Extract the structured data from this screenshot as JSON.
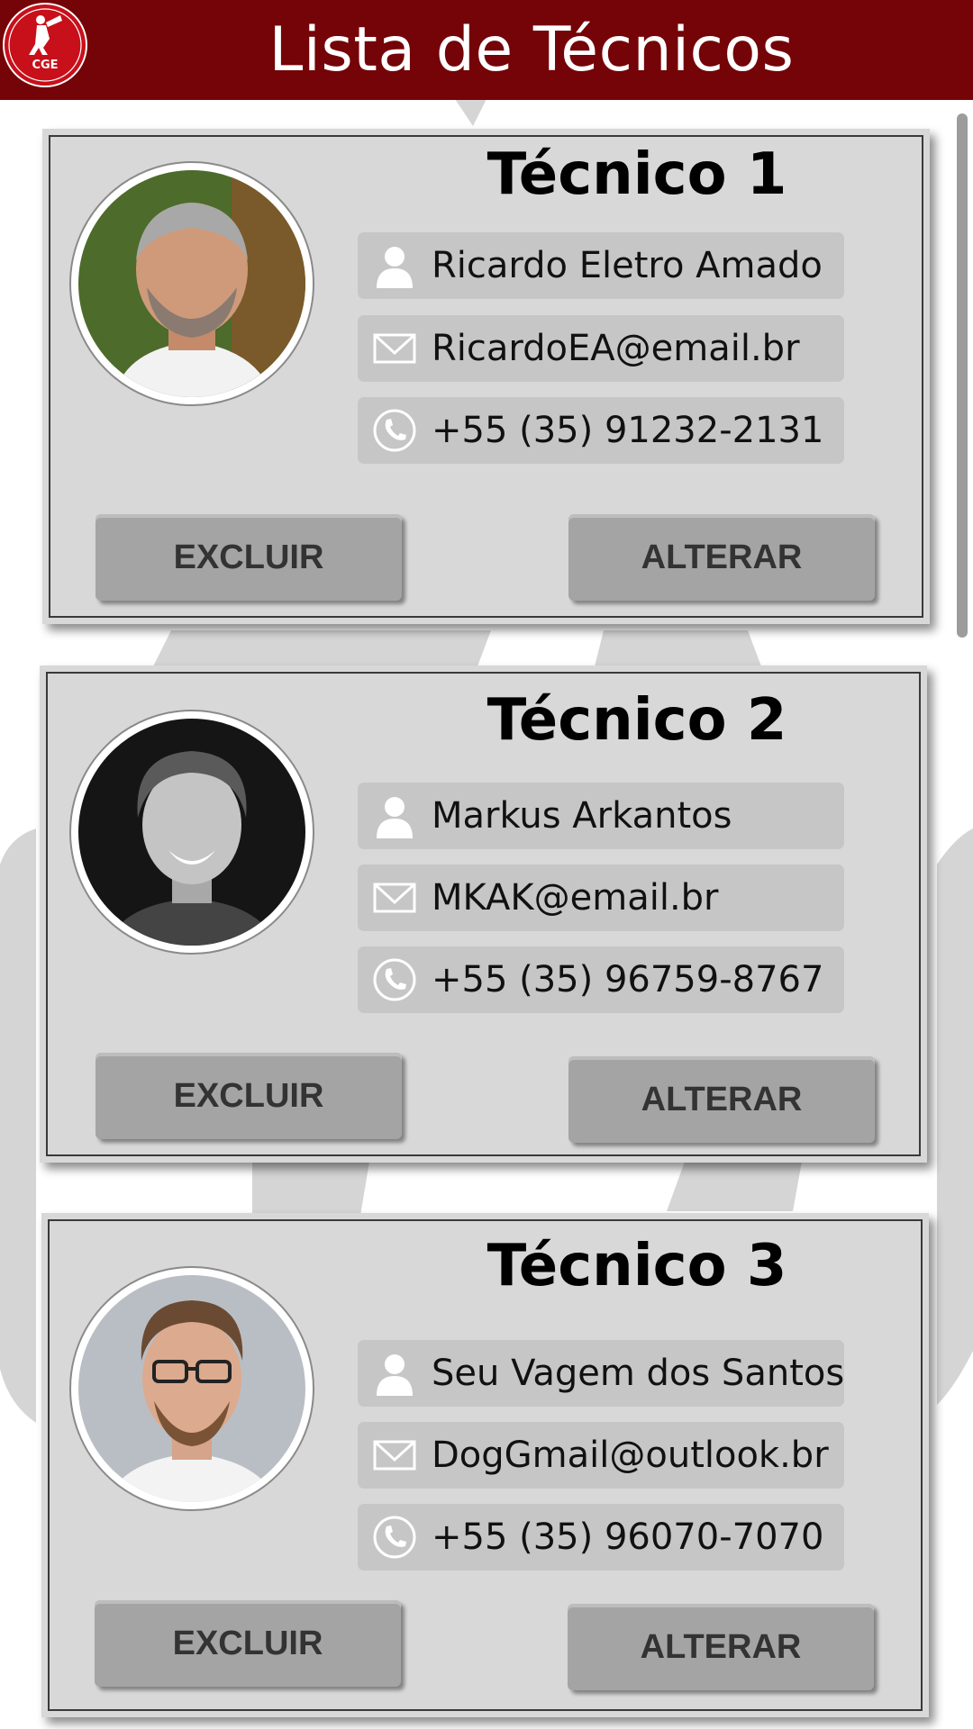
{
  "header": {
    "title": "Lista de Técnicos",
    "logo_text": "CGE"
  },
  "colors": {
    "header_bg": "#740407",
    "card_bg": "#d8d8d8",
    "field_bg": "#c6c6c6",
    "button_bg": "#a4a4a4",
    "button_text": "#333333"
  },
  "technicians": [
    {
      "title": "Técnico 1",
      "name": "Ricardo Eletro Amado",
      "email": "RicardoEA@email.br",
      "phone": "+55 (35) 91232-2131",
      "delete_label": "EXCLUIR",
      "edit_label": "ALTERAR",
      "photo_icon": "avatar-photo-older-man"
    },
    {
      "title": "Técnico 2",
      "name": "Markus Arkantos",
      "email": "MKAK@email.br",
      "phone": "+55 (35) 96759-8767",
      "delete_label": "EXCLUIR",
      "edit_label": "ALTERAR",
      "photo_icon": "avatar-photo-young-man-bw"
    },
    {
      "title": "Técnico 3",
      "name": "Seu Vagem dos Santos",
      "email": "DogGmail@outlook.br",
      "phone": "+55 (35) 96070-7070",
      "delete_label": "EXCLUIR",
      "edit_label": "ALTERAR",
      "photo_icon": "avatar-photo-man-glasses"
    }
  ],
  "icons": {
    "name_field": "person-icon",
    "email_field": "envelope-icon",
    "phone_field": "phone-icon"
  }
}
